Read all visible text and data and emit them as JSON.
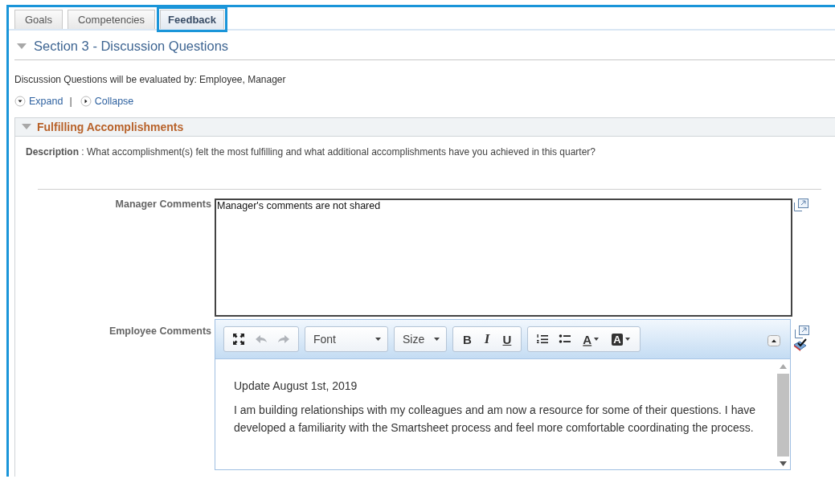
{
  "tabs": [
    {
      "label": "Goals",
      "selected": false
    },
    {
      "label": "Competencies",
      "selected": false
    },
    {
      "label": "Feedback",
      "selected": true
    }
  ],
  "section": {
    "title": "Section 3 - Discussion Questions",
    "expanded": true,
    "evaluated_by": "Discussion Questions will be evaluated by: Employee, Manager",
    "expand_link": "Expand",
    "separator": "|",
    "collapse_link": "Collapse"
  },
  "question": {
    "title": "Fulfilling Accomplishments",
    "expanded": true,
    "description_label": "Description",
    "description": ": What accomplishment(s) felt the most fulfilling and what additional accomplishments have you achieved in this quarter?"
  },
  "manager_comments": {
    "label": "Manager Comments",
    "value": "Manager's comments are not shared"
  },
  "employee_comments": {
    "label": "Employee Comments",
    "toolbar": [
      [
        {
          "kind": "fullscreen",
          "disabled": false
        },
        {
          "kind": "undo",
          "disabled": true
        },
        {
          "kind": "redo",
          "disabled": true
        }
      ],
      [
        {
          "kind": "dropdown",
          "label": "Font",
          "disabled": false
        }
      ],
      [
        {
          "kind": "dropdown",
          "label": "Size",
          "disabled": false
        }
      ],
      [
        {
          "kind": "bold",
          "label": "B",
          "disabled": false
        },
        {
          "kind": "italic",
          "label": "I",
          "disabled": false
        },
        {
          "kind": "underline",
          "label": "U",
          "disabled": false
        }
      ],
      [
        {
          "kind": "ordered-list",
          "disabled": false
        },
        {
          "kind": "bullet-list",
          "disabled": false
        },
        {
          "kind": "text-color",
          "label": "A",
          "disabled": false
        },
        {
          "kind": "bg-color",
          "label": "A",
          "disabled": false
        }
      ]
    ],
    "paragraphs": [
      "Update August 1st, 2019",
      "I am building relationships with my colleagues and am now a resource for some of their questions. I have developed a familiarity with the Smartsheet process and feel more comfortable coordinating the process."
    ]
  }
}
